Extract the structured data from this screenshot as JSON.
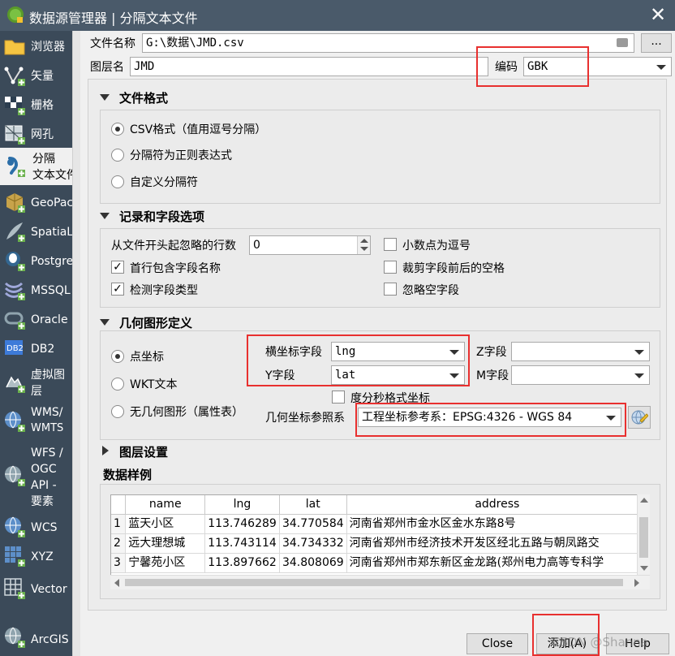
{
  "window": {
    "title": "数据源管理器 | 分隔文本文件",
    "close_glyph": "✕"
  },
  "sidebar": {
    "items": [
      {
        "label": "浏览器",
        "icon": "folder-icon"
      },
      {
        "label": "矢量",
        "icon": "vector-icon"
      },
      {
        "label": "栅格",
        "icon": "raster-icon"
      },
      {
        "label": "网孔",
        "icon": "mesh-icon"
      },
      {
        "label": "分隔",
        "label2": "文本文件",
        "icon": "delimited-text-icon"
      },
      {
        "label": "GeoPackage",
        "icon": "geopackage-icon"
      },
      {
        "label": "SpatiaLite",
        "icon": "spatialite-icon"
      },
      {
        "label": "PostgreSQL",
        "icon": "postgresql-icon"
      },
      {
        "label": "MSSQL",
        "icon": "mssql-icon"
      },
      {
        "label": "Oracle",
        "icon": "oracle-icon"
      },
      {
        "label": "DB2",
        "icon": "db2-icon"
      },
      {
        "label": "虚拟图",
        "label2": "层",
        "icon": "virtual-layer-icon"
      },
      {
        "label": "WMS/",
        "label2": "WMTS",
        "icon": "wms-icon"
      },
      {
        "label": "WFS /",
        "label2": "OGC",
        "label3": "API -",
        "label4": "要素",
        "icon": "wfs-icon"
      },
      {
        "label": "WCS",
        "icon": "wcs-icon"
      },
      {
        "label": "XYZ",
        "icon": "xyz-icon"
      },
      {
        "label": "Vector",
        "icon": "vector-tile-icon"
      },
      {
        "label": "ArcGIS",
        "icon": "arcgis-icon"
      }
    ]
  },
  "file": {
    "label": "文件名称",
    "value": "G:\\数据\\JMD.csv",
    "browse_label": "..."
  },
  "layer": {
    "label": "图层名",
    "value": "JMD",
    "encoding_label": "编码",
    "encoding_value": "GBK"
  },
  "file_format": {
    "header": "文件格式",
    "options": [
      "CSV格式（值用逗号分隔）",
      "分隔符为正则表达式",
      "自定义分隔符"
    ],
    "selected": 0
  },
  "records": {
    "header": "记录和字段选项",
    "skip_label": "从文件开头起忽略的行数",
    "skip_value": "0",
    "first_record_label": "首行包含字段名称",
    "detect_types_label": "检测字段类型",
    "decimal_comma_label": "小数点为逗号",
    "trim_label": "裁剪字段前后的空格",
    "discard_empty_label": "忽略空字段",
    "check_mark": "✓"
  },
  "geometry": {
    "header": "几何图形定义",
    "options": [
      "点坐标",
      "WKT文本",
      "无几何图形（属性表）"
    ],
    "selected": 0,
    "x_label": "横坐标字段",
    "x_value": "lng",
    "y_label": "Y字段",
    "y_value": "lat",
    "z_label": "Z字段",
    "m_label": "M字段",
    "dms_label": "度分秒格式坐标",
    "crs_label": "几何坐标参照系",
    "crs_value": "工程坐标参考系：EPSG:4326 - WGS 84"
  },
  "layer_settings": {
    "header": "图层设置"
  },
  "sample": {
    "header": "数据样例",
    "columns": [
      "name",
      "lng",
      "lat",
      "address"
    ],
    "rows": [
      {
        "num": "1",
        "name": "蓝天小区",
        "lng": "113.746289",
        "lat": "34.770584",
        "address": "河南省郑州市金水区金水东路8号"
      },
      {
        "num": "2",
        "name": "远大理想城",
        "lng": "113.743114",
        "lat": "34.734332",
        "address": "河南省郑州市经济技术开发区经北五路与朝凤路交"
      },
      {
        "num": "3",
        "name": "宁馨苑小区",
        "lng": "113.897662",
        "lat": "34.808069",
        "address": "河南省郑州市郑东新区金龙路(郑州电力高等专科学"
      }
    ]
  },
  "buttons": {
    "close": "Close",
    "add": "添加(A)",
    "help": "Help"
  },
  "watermark": "CSDN @Shanna",
  "colors": {
    "sidebar_bg": "#3b4a59",
    "title_bg": "#4a5a6a",
    "highlight": "#e8302f"
  }
}
